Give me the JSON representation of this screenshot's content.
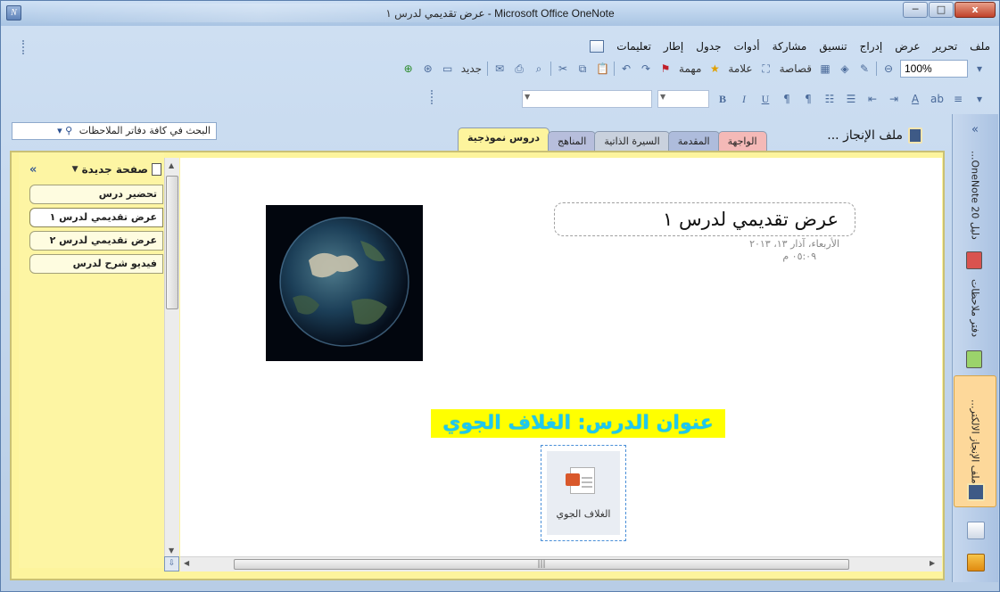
{
  "window": {
    "title": "Microsoft Office OneNote - عرض تقديمي لدرس ١",
    "app_icon_glyph": "N",
    "buttons": {
      "minimize": "─",
      "maximize": "□",
      "close": "x"
    }
  },
  "menubar": [
    "ملف",
    "تحرير",
    "عرض",
    "إدراج",
    "تنسيق",
    "مشاركة",
    "أدوات",
    "جدول",
    "إطار",
    "تعليمات"
  ],
  "toolbar": {
    "zoom": "100%",
    "tag_label": "علامة",
    "task_label": "مهمة",
    "clip_label": "قصاصة",
    "new_label": "جديد"
  },
  "format_toolbar": {
    "bold": "B",
    "italic": "I",
    "underline": "U"
  },
  "search": {
    "label": "البحث في كافة دفاتر الملاحظات"
  },
  "notebook": {
    "title": "ملف الإنجاز ..."
  },
  "tabs": [
    "الواجهة",
    "المقدمة",
    "السيرة الذاتية",
    "المناهج",
    "دروس نموذجية"
  ],
  "pages": {
    "new_page": "صفحة جديدة",
    "collapse": "«",
    "items": [
      "تحضير درس",
      "عرض تقديمي لدرس ١",
      "عرض تقديمي لدرس ٢",
      "فيديو شرح لدرس"
    ]
  },
  "page": {
    "title": "عرض تقديمي لدرس ١",
    "date": "الأربعاء، آذار ١٣، ٢٠١٣",
    "time": "٠٥:٠٩ م",
    "heading": "عنوان الدرس: الغلاف الجوي",
    "attachment_caption": "الغلاف الجوي"
  },
  "navbar": {
    "collapse": "«",
    "items": [
      "دليل OneNote 20...",
      "دفتر ملاحظات",
      "ملف الإنجاز الالكتر..."
    ]
  },
  "colors": {
    "section_active": "#fdf49d",
    "heading_bg": "#ffff00",
    "heading_text": "#1ec8f0",
    "swatch_red": "#d9534f",
    "swatch_green": "#9bd36b"
  }
}
